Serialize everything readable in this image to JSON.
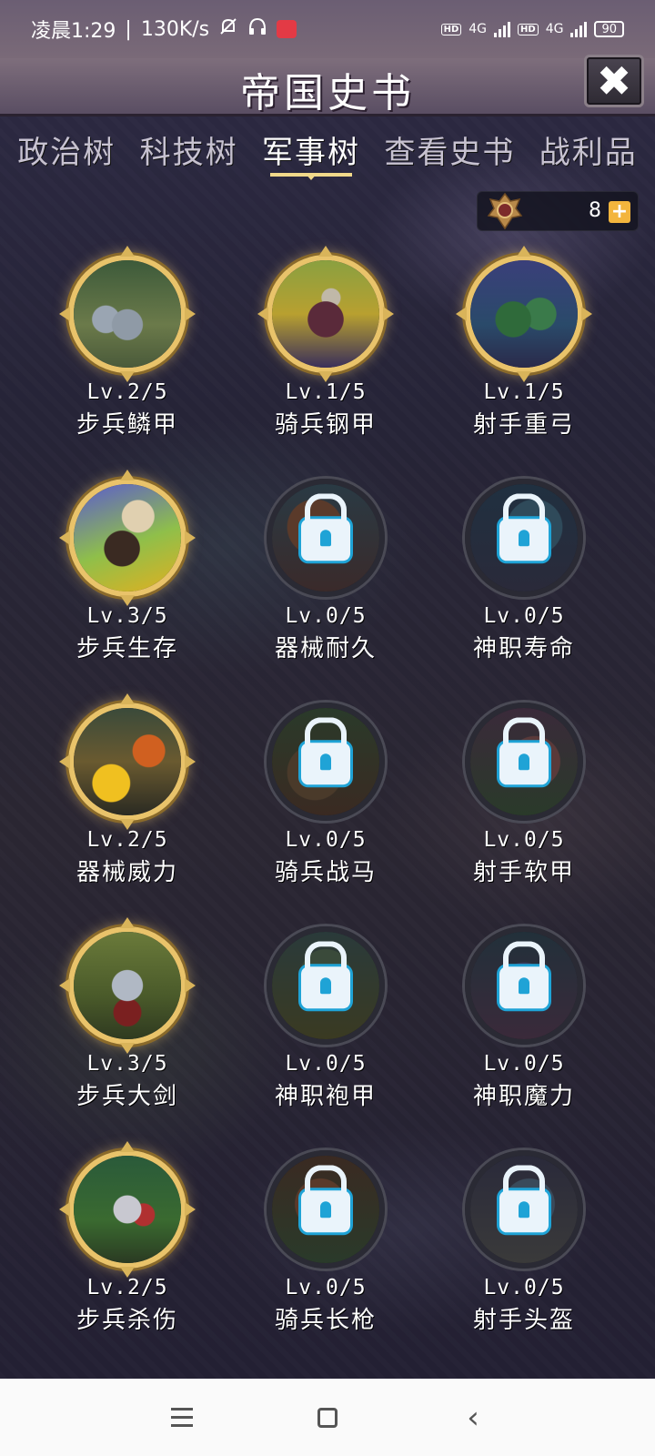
{
  "status_bar": {
    "time": "凌晨1:29",
    "speed": "130K/s",
    "network1": "4G",
    "network2": "4G",
    "battery": "90"
  },
  "header": {
    "title": "帝国史书",
    "close_icon": "close-icon"
  },
  "tabs": [
    {
      "label": "政治树",
      "active": false
    },
    {
      "label": "科技树",
      "active": false
    },
    {
      "label": "军事树",
      "active": true
    },
    {
      "label": "查看史书",
      "active": false
    },
    {
      "label": "战利品",
      "active": false
    }
  ],
  "currency": {
    "icon": "emblem-icon",
    "count": "8",
    "add_icon": "plus-icon"
  },
  "skills": [
    {
      "level": "Lv.2/5",
      "name": "步兵鳞甲",
      "locked": false,
      "art": "two-knights"
    },
    {
      "level": "Lv.1/5",
      "name": "骑兵钢甲",
      "locked": false,
      "art": "horseman"
    },
    {
      "level": "Lv.1/5",
      "name": "射手重弓",
      "locked": false,
      "art": "archers"
    },
    {
      "level": "Lv.3/5",
      "name": "步兵生存",
      "locked": false,
      "art": "warrior-ruins"
    },
    {
      "level": "Lv.0/5",
      "name": "器械耐久",
      "locked": true,
      "art": "lock-icon"
    },
    {
      "level": "Lv.0/5",
      "name": "神职寿命",
      "locked": true,
      "art": "lock-icon"
    },
    {
      "level": "Lv.2/5",
      "name": "器械威力",
      "locked": false,
      "art": "siege-forge"
    },
    {
      "level": "Lv.0/5",
      "name": "骑兵战马",
      "locked": true,
      "art": "lock-icon"
    },
    {
      "level": "Lv.0/5",
      "name": "射手软甲",
      "locked": true,
      "art": "lock-icon"
    },
    {
      "level": "Lv.3/5",
      "name": "步兵大剑",
      "locked": false,
      "art": "greatsword-knight"
    },
    {
      "level": "Lv.0/5",
      "name": "神职袍甲",
      "locked": true,
      "art": "lock-icon"
    },
    {
      "level": "Lv.0/5",
      "name": "神职魔力",
      "locked": true,
      "art": "lock-icon"
    },
    {
      "level": "Lv.2/5",
      "name": "步兵杀伤",
      "locked": false,
      "art": "charging-knight"
    },
    {
      "level": "Lv.0/5",
      "name": "骑兵长枪",
      "locked": true,
      "art": "lock-icon"
    },
    {
      "level": "Lv.0/5",
      "name": "射手头盔",
      "locked": true,
      "art": "lock-icon"
    }
  ],
  "colors": {
    "gold_frame": "#e9c36a",
    "lock_blue": "#1fa3d6",
    "tab_underline": "#f1d98a"
  },
  "nav": {
    "menu_icon": "menu-icon",
    "home_icon": "home-icon",
    "back_icon": "back-icon"
  }
}
